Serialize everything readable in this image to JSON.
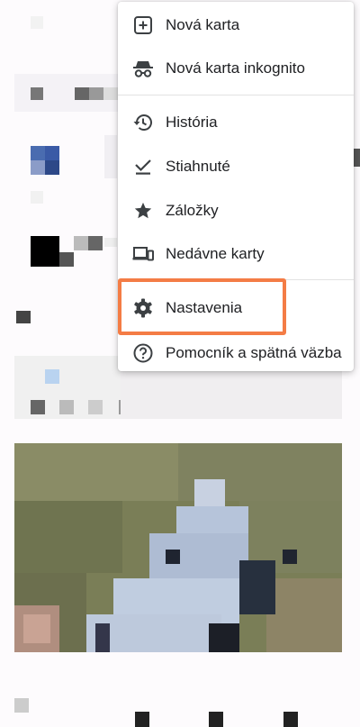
{
  "menu": {
    "items": [
      {
        "label": "Nová karta",
        "icon": "new-tab-icon"
      },
      {
        "label": "Nová karta inkognito",
        "icon": "incognito-icon"
      },
      {
        "label": "História",
        "icon": "history-icon"
      },
      {
        "label": "Stiahnuté",
        "icon": "downloads-icon"
      },
      {
        "label": "Záložky",
        "icon": "star-icon"
      },
      {
        "label": "Nedávne karty",
        "icon": "recent-tabs-icon"
      },
      {
        "label": "Nastavenia",
        "icon": "gear-icon"
      },
      {
        "label": "Pomocník a spätná väzba",
        "icon": "help-icon"
      }
    ]
  },
  "highlight_color": "#f47c45"
}
